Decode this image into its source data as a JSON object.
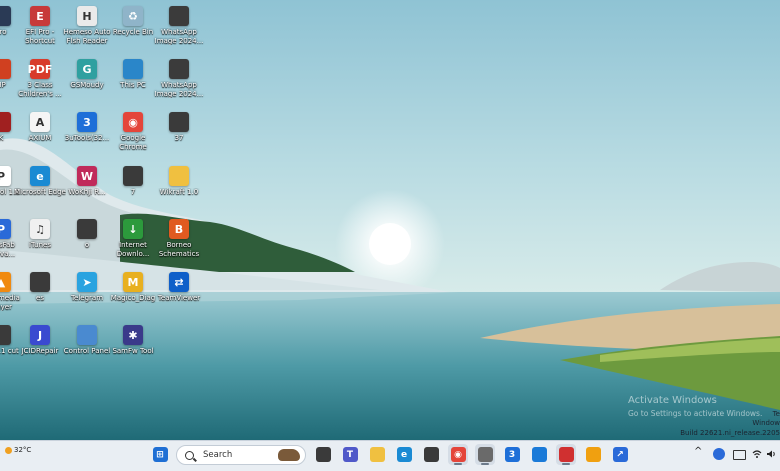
{
  "desktop": {
    "icons": [
      {
        "name": "desktop-icon-pro-partial",
        "label": "Pro",
        "glyph": "",
        "color": "#2a3a55"
      },
      {
        "name": "desktop-icon-efi-pro-shortcut",
        "label": "EFI Pro - Shortcut",
        "glyph": "E",
        "color": "#c73a3a"
      },
      {
        "name": "desktop-icon-hemeso-auto-flash",
        "label": "Hemeso Auto Flsh Reader",
        "glyph": "H",
        "color": "#eaeaea"
      },
      {
        "name": "desktop-icon-recycle-bin",
        "label": "Recycle Bin",
        "glyph": "♻",
        "color": "#8fb4c9"
      },
      {
        "name": "desktop-icon-whatsapp-image-1",
        "label": "WhatsApp Image 2024...",
        "glyph": "",
        "color": "#3b3b3b"
      },
      {
        "name": "desktop-icon-hp-partial",
        "label": "HP",
        "glyph": "",
        "color": "#d04020"
      },
      {
        "name": "desktop-icon-pdf-children",
        "label": "3 Class Children's ...",
        "glyph": "PDF",
        "color": "#d83b2b"
      },
      {
        "name": "desktop-icon-gsmoudy",
        "label": "GSMoudy",
        "glyph": "G",
        "color": "#2fa0a0"
      },
      {
        "name": "desktop-icon-this-pc",
        "label": "This PC",
        "glyph": "",
        "color": "#2a86c9"
      },
      {
        "name": "desktop-icon-whatsapp-image-2",
        "label": "WhatsApp Image 2024...",
        "glyph": "",
        "color": "#3b3b3b"
      },
      {
        "name": "desktop-icon-k-partial",
        "label": "K",
        "glyph": "",
        "color": "#a02020"
      },
      {
        "name": "desktop-icon-axium",
        "label": "AXIUM",
        "glyph": "A",
        "color": "#f5f5f5"
      },
      {
        "name": "desktop-icon-3utools-partial",
        "label": "3uTools(32...",
        "glyph": "3",
        "color": "#1e6fd8"
      },
      {
        "name": "desktop-icon-google-chrome",
        "label": "Google Chrome",
        "glyph": "◉",
        "color": "#e4453a"
      },
      {
        "name": "desktop-icon-37-partial",
        "label": "37",
        "glyph": "",
        "color": "#3a3a3a"
      },
      {
        "name": "desktop-icon-pl-tool",
        "label": "PL Tool 1.0",
        "glyph": "P",
        "color": "#ffffff"
      },
      {
        "name": "desktop-icon-microsoft-edge",
        "label": "Microsoft Edge",
        "glyph": "e",
        "color": "#1a8ad3"
      },
      {
        "name": "desktop-icon-wokhji",
        "label": "WoKhji R...",
        "glyph": "W",
        "color": "#c02a5a"
      },
      {
        "name": "desktop-icon-7-partial",
        "label": "7",
        "glyph": "",
        "color": "#3a3a3a"
      },
      {
        "name": "desktop-icon-wikraft-folder",
        "label": "Wikraft 1.0",
        "glyph": "",
        "color": "#f0c040"
      },
      {
        "name": "desktop-icon-passfab",
        "label": "PassFab Activa...",
        "glyph": "P",
        "color": "#2a6ad8"
      },
      {
        "name": "desktop-icon-itunes",
        "label": "iTunes",
        "glyph": "♫",
        "color": "#f0f0f0"
      },
      {
        "name": "desktop-icon-o-partial",
        "label": "o",
        "glyph": "",
        "color": "#3a3a3a"
      },
      {
        "name": "desktop-icon-internet-download",
        "label": "Internet Downlo...",
        "glyph": "↓",
        "color": "#2c9a3c"
      },
      {
        "name": "desktop-icon-borneo-schematics",
        "label": "Borneo Schematics",
        "glyph": "B",
        "color": "#e05a20"
      },
      {
        "name": "desktop-icon-vlc-media-player",
        "label": "VLC media player",
        "glyph": "▲",
        "color": "#f08a10"
      },
      {
        "name": "desktop-icon-es-partial",
        "label": "es",
        "glyph": "",
        "color": "#3a3a3a"
      },
      {
        "name": "desktop-icon-telegram",
        "label": "Telegram",
        "glyph": "➤",
        "color": "#2aa3e0"
      },
      {
        "name": "desktop-icon-magico-diag",
        "label": "Magico_Diag",
        "glyph": "M",
        "color": "#e8b020"
      },
      {
        "name": "desktop-icon-teamviewer",
        "label": "TeamViewer",
        "glyph": "⇄",
        "color": "#0e5fc9"
      },
      {
        "name": "desktop-icon-cut-partial",
        "label": "3.14.1 cut",
        "glyph": "",
        "color": "#3a3a3a"
      },
      {
        "name": "desktop-icon-jcidrepair",
        "label": "JCIDRepair",
        "glyph": "J",
        "color": "#3a4ad0"
      },
      {
        "name": "desktop-icon-control-panel",
        "label": "Control Panel",
        "glyph": "",
        "color": "#4a8ad0"
      },
      {
        "name": "desktop-icon-samfw-tool",
        "label": "SamFw Tool",
        "glyph": "✱",
        "color": "#3a3a8a"
      }
    ]
  },
  "watermark": {
    "title": "Activate Windows",
    "subtitle": "Go to Settings to activate Windows.",
    "edition_partial": "Te",
    "os_partial": "Window",
    "build": "Build 22621.ni_release.2205"
  },
  "taskbar": {
    "weather_temp": "32°C",
    "search_placeholder": "Search",
    "apps": [
      {
        "name": "start-button",
        "glyph": "⊞",
        "color": "#1f6fd4",
        "active": false
      },
      {
        "name": "taskbar-widget",
        "glyph": "",
        "color": "#3a3a3a",
        "active": false
      },
      {
        "name": "taskbar-teams",
        "glyph": "T",
        "color": "#5059c9",
        "active": false
      },
      {
        "name": "taskbar-file-explorer",
        "glyph": "",
        "color": "#f0c040",
        "active": false
      },
      {
        "name": "taskbar-edge",
        "glyph": "e",
        "color": "#1a8ad3",
        "active": false
      },
      {
        "name": "taskbar-store",
        "glyph": "",
        "color": "#3a3a3a",
        "active": false
      },
      {
        "name": "taskbar-chrome",
        "glyph": "◉",
        "color": "#e4453a",
        "active": true
      },
      {
        "name": "taskbar-app-active",
        "glyph": "",
        "color": "#6a6a6a",
        "active": true
      },
      {
        "name": "taskbar-3utools",
        "glyph": "3",
        "color": "#1e6fd8",
        "active": false
      },
      {
        "name": "taskbar-shield",
        "glyph": "",
        "color": "#1a7ad8",
        "active": false
      },
      {
        "name": "taskbar-app-red",
        "glyph": "",
        "color": "#d03030",
        "active": true
      },
      {
        "name": "taskbar-app-orange",
        "glyph": "",
        "color": "#f0a010",
        "active": false
      },
      {
        "name": "taskbar-app-blue",
        "glyph": "↗",
        "color": "#2a6ad8",
        "active": false
      }
    ],
    "tray": {
      "chevron": "^"
    }
  }
}
